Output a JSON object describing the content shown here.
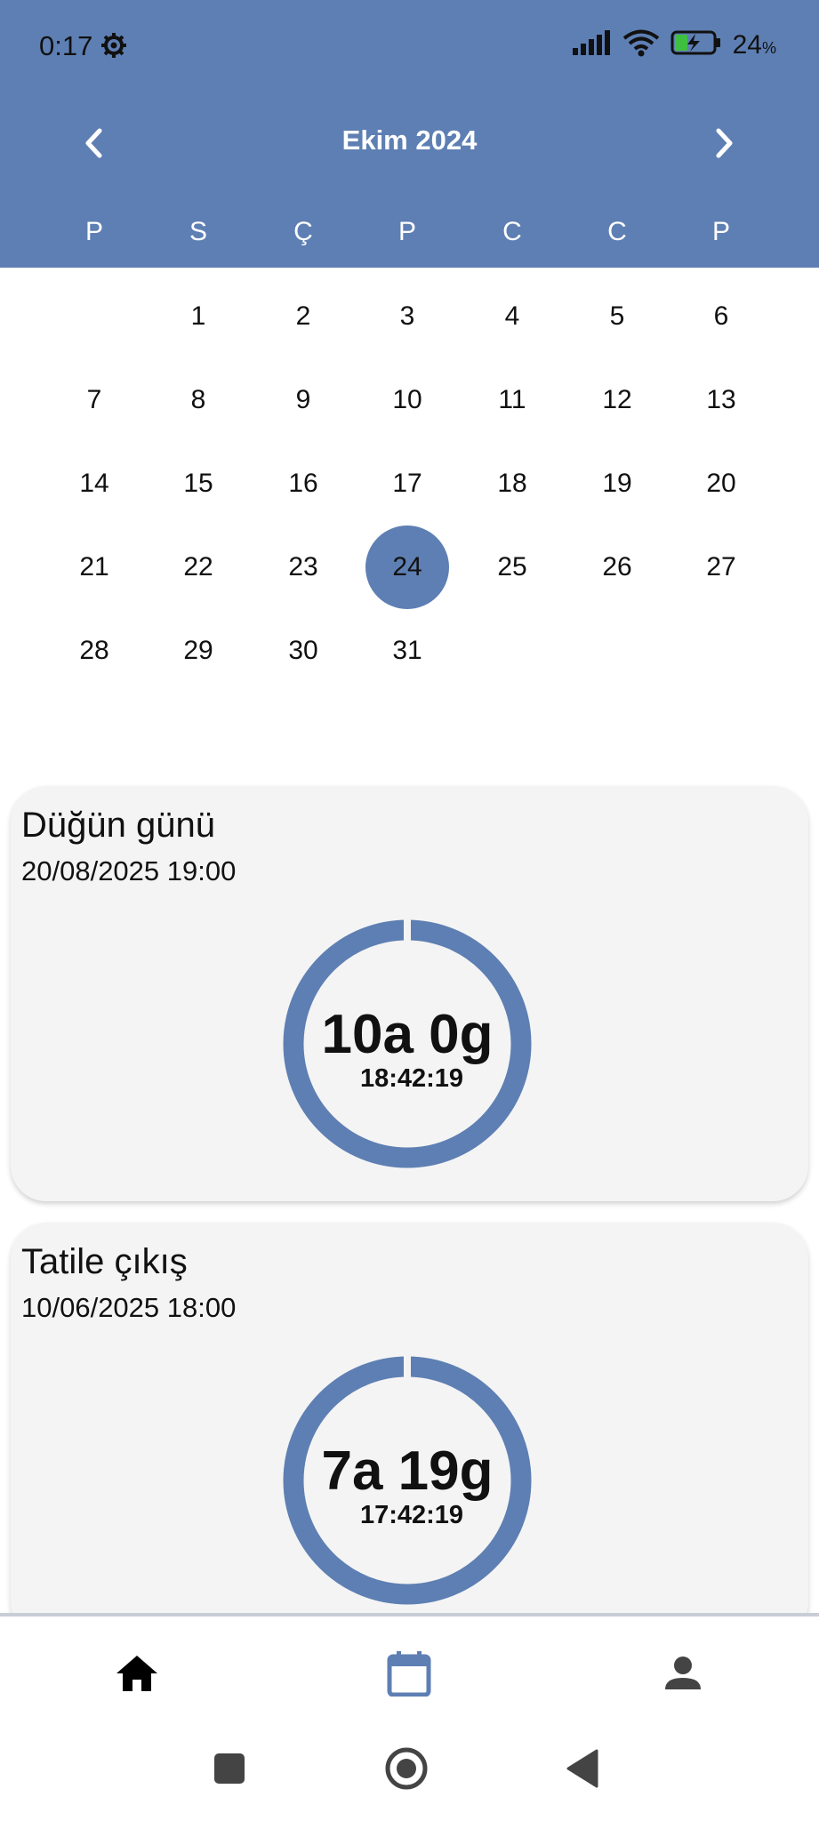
{
  "status_bar": {
    "time": "0:17",
    "battery_percent": "24",
    "battery_percent_sign": "%",
    "icons": [
      "gear-icon",
      "signal-icon",
      "wifi-icon",
      "battery-charging-icon"
    ]
  },
  "calendar": {
    "month_title": "Ekim 2024",
    "prev_icon": "chevron-left-icon",
    "next_icon": "chevron-right-icon",
    "weekdays": [
      "P",
      "S",
      "Ç",
      "P",
      "C",
      "C",
      "P"
    ],
    "first_weekday_index": 1,
    "days_in_month": 31,
    "selected_day": 24,
    "days": [
      "1",
      "2",
      "3",
      "4",
      "5",
      "6",
      "7",
      "8",
      "9",
      "10",
      "11",
      "12",
      "13",
      "14",
      "15",
      "16",
      "17",
      "18",
      "19",
      "20",
      "21",
      "22",
      "23",
      "24",
      "25",
      "26",
      "27",
      "28",
      "29",
      "30",
      "31"
    ]
  },
  "events": [
    {
      "title": "Düğün günü",
      "date": "20/08/2025 19:00",
      "countdown_main": "10a 0g",
      "countdown_time": "18:42:19"
    },
    {
      "title": "Tatile çıkış",
      "date": "10/06/2025 18:00",
      "countdown_main": "7a 19g",
      "countdown_time": "17:42:19"
    }
  ],
  "bottom_nav": {
    "items": [
      "home-icon",
      "calendar-icon",
      "person-icon"
    ],
    "active": "calendar-icon"
  },
  "system_nav": {
    "items": [
      "recent-apps-icon",
      "home-circle-icon",
      "back-triangle-icon"
    ]
  },
  "colors": {
    "accent": "#5e7fb3",
    "card_bg": "#f4f4f4",
    "text": "#111111",
    "header_text": "#ffffff"
  }
}
